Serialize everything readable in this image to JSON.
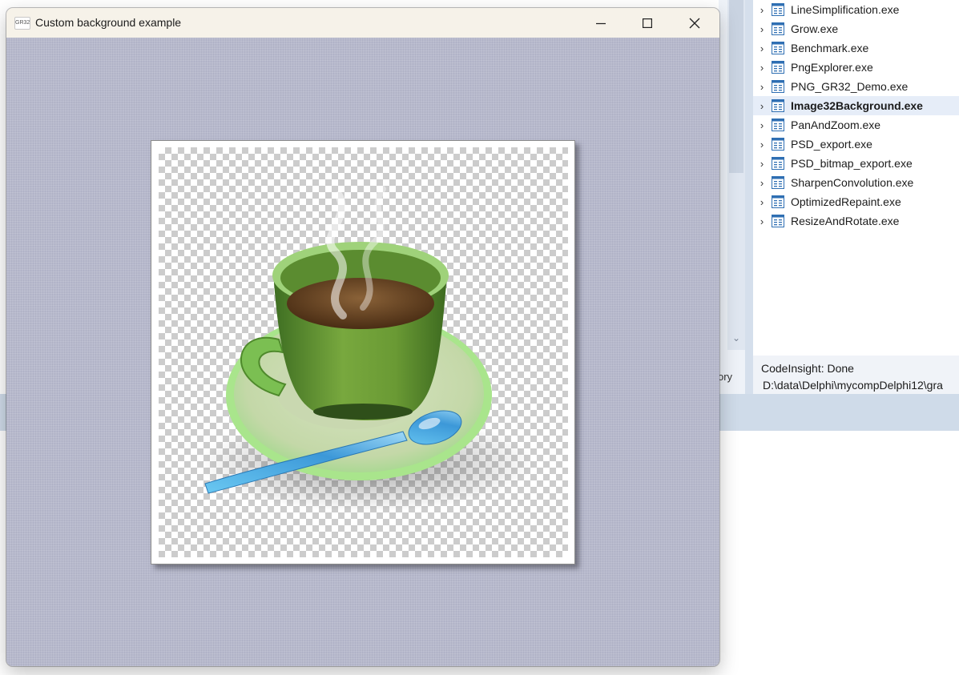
{
  "window": {
    "title": "Custom background example",
    "app_icon_text": "GR32",
    "minimize_label": "Minimize",
    "maximize_label": "Maximize",
    "close_label": "Close"
  },
  "image": {
    "subject": "green teacup with spoon on saucer over transparency checkerboard"
  },
  "ide": {
    "project_items": [
      {
        "label": "LineSimplification.exe",
        "selected": false
      },
      {
        "label": "Grow.exe",
        "selected": false
      },
      {
        "label": "Benchmark.exe",
        "selected": false
      },
      {
        "label": "PngExplorer.exe",
        "selected": false
      },
      {
        "label": "PNG_GR32_Demo.exe",
        "selected": false
      },
      {
        "label": "Image32Background.exe",
        "selected": true
      },
      {
        "label": "PanAndZoom.exe",
        "selected": false
      },
      {
        "label": "PSD_export.exe",
        "selected": false
      },
      {
        "label": "PSD_bitmap_export.exe",
        "selected": false
      },
      {
        "label": "SharpenConvolution.exe",
        "selected": false
      },
      {
        "label": "OptimizedRepaint.exe",
        "selected": false
      },
      {
        "label": "ResizeAndRotate.exe",
        "selected": false
      }
    ],
    "lower_left_text": "ory",
    "status_line1": "CodeInsight: Done",
    "status_line2": "D:\\data\\Delphi\\mycompDelphi12\\gra"
  },
  "colors": {
    "title_bar": "#f6f2e9",
    "client_background": "#b7b9cc",
    "selection": "#e6edf8"
  },
  "icons": [
    "gr32-app-icon",
    "minimize-icon",
    "maximize-icon",
    "close-icon",
    "chevron-right-icon",
    "exe-file-icon",
    "chevron-down-icon"
  ]
}
